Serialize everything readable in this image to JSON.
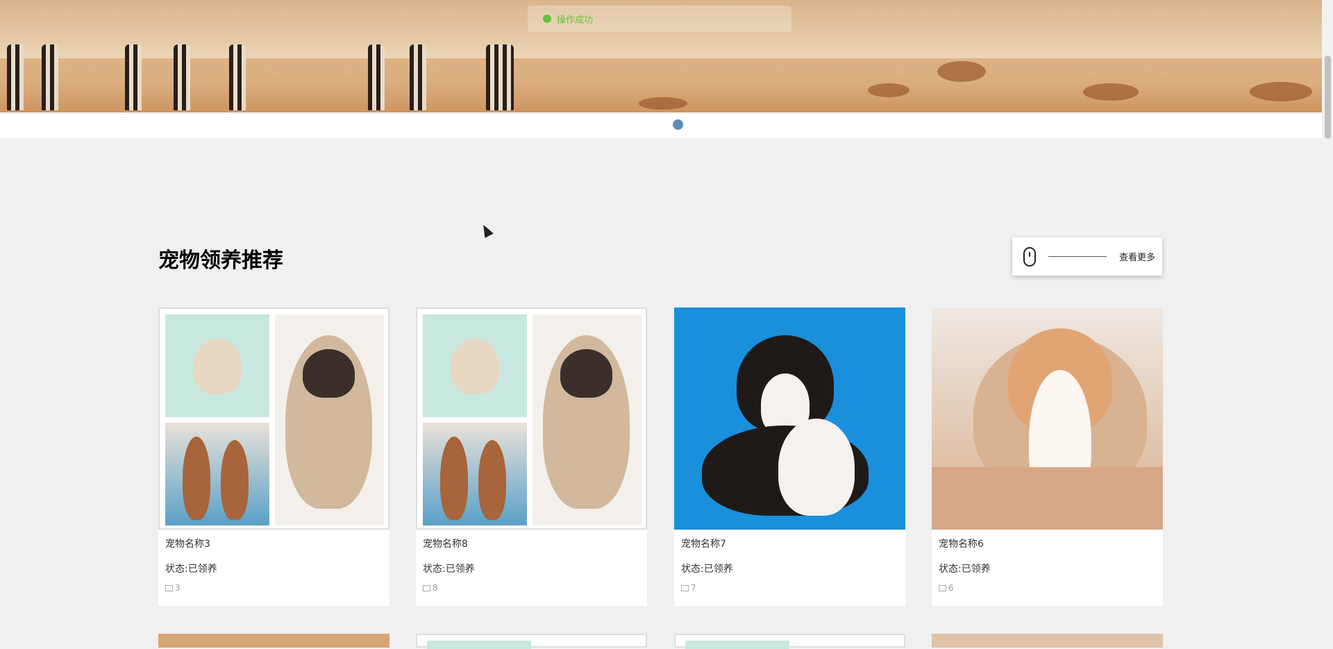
{
  "toast": {
    "text": "操作成功"
  },
  "banner": {
    "dot_count": 1
  },
  "section": {
    "title": "宠物领养推荐",
    "more_label": "查看更多"
  },
  "cards": [
    {
      "name": "宠物名称3",
      "status": "状态:已领养",
      "views": "3",
      "image": "collage"
    },
    {
      "name": "宠物名称8",
      "status": "状态:已领养",
      "views": "8",
      "image": "collage"
    },
    {
      "name": "宠物名称7",
      "status": "状态:已领养",
      "views": "7",
      "image": "blue-corgi"
    },
    {
      "name": "宠物名称6",
      "status": "状态:已领养",
      "views": "6",
      "image": "teddy-corgi"
    }
  ],
  "colors": {
    "accent": "#5a8fb8",
    "success": "#67c23a",
    "page_bg": "#f0f0f0"
  }
}
